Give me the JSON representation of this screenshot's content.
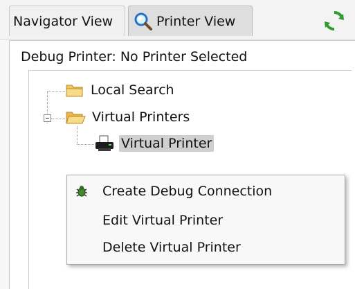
{
  "tabs": {
    "navigator_label": "Navigator View",
    "printer_label": "Printer View"
  },
  "panel": {
    "debug_printer_label": "Debug Printer: No Printer Selected"
  },
  "tree": {
    "nodes": [
      {
        "label": "Local Search",
        "icon": "folder-icon"
      },
      {
        "label": "Virtual Printers",
        "icon": "folder-open-icon"
      },
      {
        "label": "Virtual Printer",
        "icon": "printer-icon"
      }
    ]
  },
  "context_menu": {
    "items": [
      {
        "label": "Create Debug Connection",
        "icon": "bug-icon"
      },
      {
        "label": "Edit Virtual Printer"
      },
      {
        "label": "Delete Virtual Printer"
      }
    ]
  },
  "colors": {
    "selected_bg": "#cfcfcf",
    "folder": "#f2c95c",
    "refresh_green": "#2e9b2e"
  }
}
